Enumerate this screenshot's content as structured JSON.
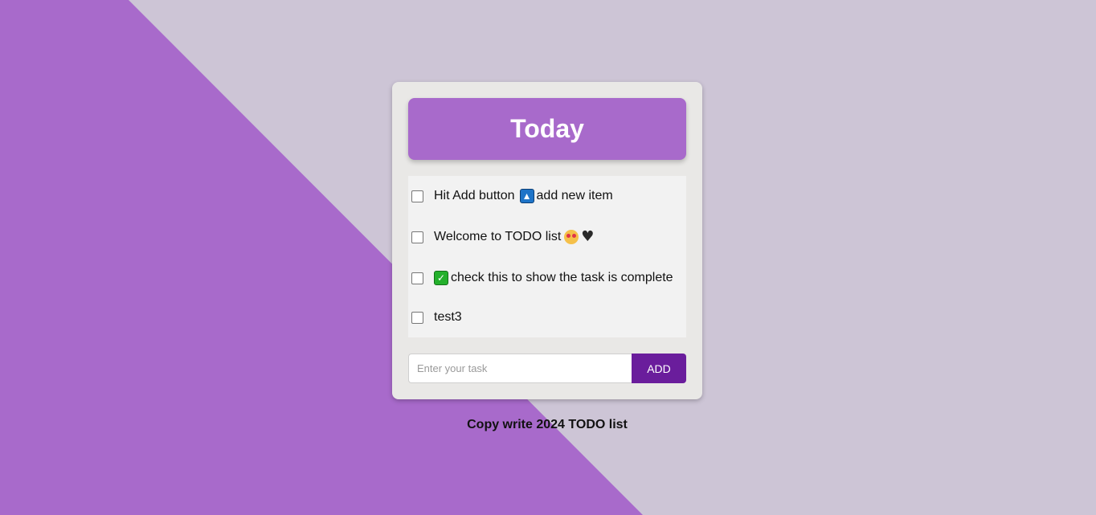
{
  "header": {
    "title": "Today"
  },
  "todo": {
    "items": [
      {
        "parts": [
          "Hit Add button",
          "add new item"
        ],
        "icon": "up-arrow-button-icon",
        "checked": false
      },
      {
        "parts": [
          "Welcome to TODO list"
        ],
        "icons": [
          "star-struck-face-icon",
          "black-heart-icon"
        ],
        "checked": false
      },
      {
        "parts": [
          "check this to show the task is complete"
        ],
        "icon": "check-mark-button-icon",
        "checked": false
      },
      {
        "parts": [
          "test3"
        ],
        "checked": false
      }
    ]
  },
  "input": {
    "placeholder": "Enter your task",
    "value": ""
  },
  "add_button": {
    "label": "ADD"
  },
  "footer": {
    "text": "Copy write 2024 TODO list"
  },
  "colors": {
    "background": "#cdc5d6",
    "accent": "#a86acb",
    "button": "#6a1d9c",
    "card": "#e9e8e6",
    "list": "#f2f2f2"
  }
}
